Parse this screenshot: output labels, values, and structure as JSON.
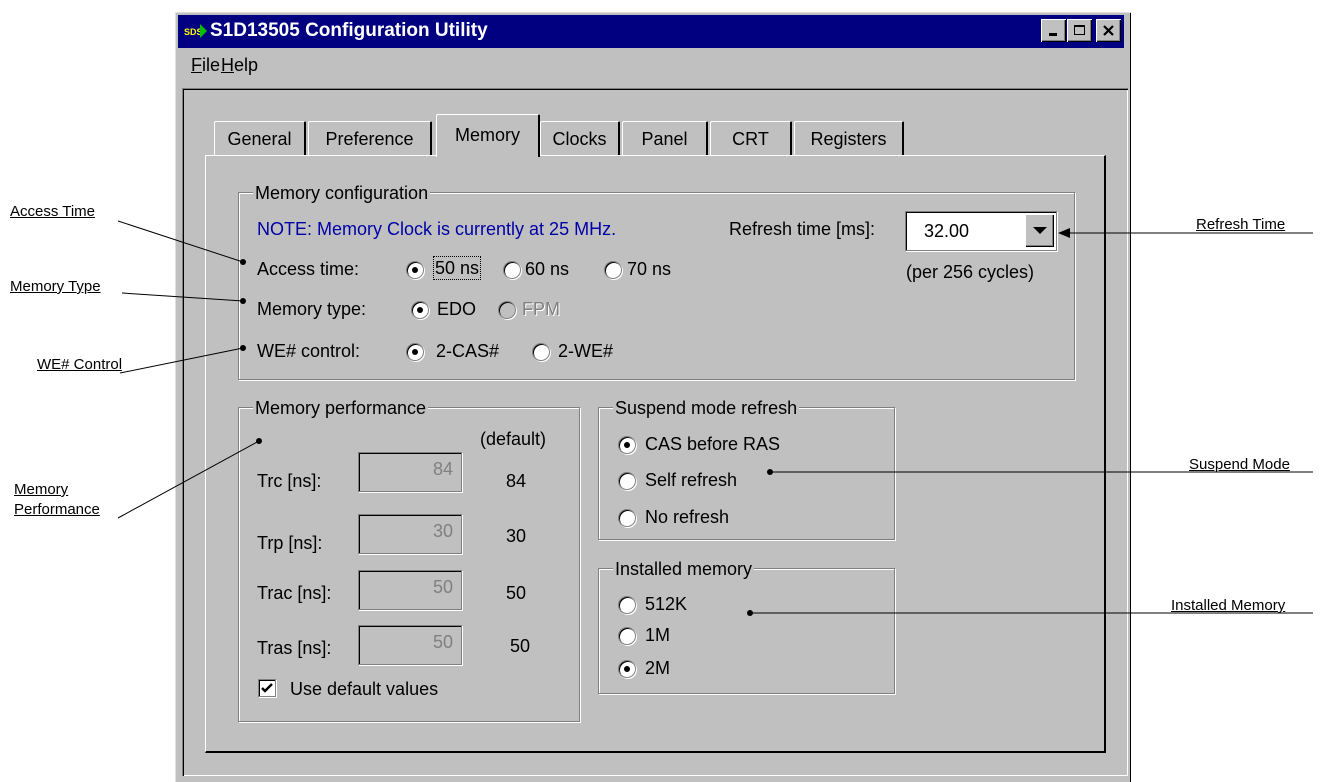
{
  "window": {
    "title": "S1D13505 Configuration Utility",
    "icon": "sds-app-icon",
    "colors": {
      "titlebar": "#000080",
      "face": "#c0c0c0",
      "note": "#0000a8"
    }
  },
  "menu": {
    "file": "File",
    "file_key": "F",
    "file_rest": "ile",
    "help_key": "H",
    "help_rest": "elp"
  },
  "tabs": [
    "General",
    "Preference",
    "Memory",
    "Clocks",
    "Panel",
    "CRT",
    "Registers"
  ],
  "active_tab": "Memory",
  "memory_config": {
    "legend": "Memory configuration",
    "note": "NOTE: Memory Clock is currently at 25 MHz.",
    "refresh_label": "Refresh time [ms]:",
    "refresh_value": "32.00",
    "refresh_sub": "(per 256 cycles)",
    "access_label": "Access time:",
    "access_options": [
      "50 ns",
      "60 ns",
      "70 ns"
    ],
    "access_selected": "50 ns",
    "type_label": "Memory type:",
    "type_options": [
      "EDO",
      "FPM"
    ],
    "type_selected": "EDO",
    "we_label": "WE# control:",
    "we_options": [
      "2-CAS#",
      "2-WE#"
    ],
    "we_selected": "2-CAS#"
  },
  "performance": {
    "legend": "Memory performance",
    "default_header": "(default)",
    "rows": [
      {
        "label": "Trc [ns]:",
        "value": "84",
        "default": "84"
      },
      {
        "label": "Trp [ns]:",
        "value": "30",
        "default": "30"
      },
      {
        "label": "Trac [ns]:",
        "value": "50",
        "default": "50"
      },
      {
        "label": "Tras [ns]:",
        "value": "50",
        "default": "50"
      }
    ],
    "use_default_label": "Use default values",
    "use_default_checked": true
  },
  "suspend": {
    "legend": "Suspend mode refresh",
    "options": [
      "CAS before RAS",
      "Self refresh",
      "No refresh"
    ],
    "selected": "CAS before RAS"
  },
  "installed": {
    "legend": "Installed memory",
    "options": [
      "512K",
      "1M",
      "2M"
    ],
    "selected": "2M"
  },
  "callouts": {
    "access_time": "Access Time",
    "memory_type": "Memory Type",
    "we_control": "WE# Control",
    "memory_performance_1": "Memory",
    "memory_performance_2": "Performance",
    "refresh_time": "Refresh Time",
    "suspend_mode": "Suspend Mode",
    "installed_memory": "Installed Memory"
  }
}
